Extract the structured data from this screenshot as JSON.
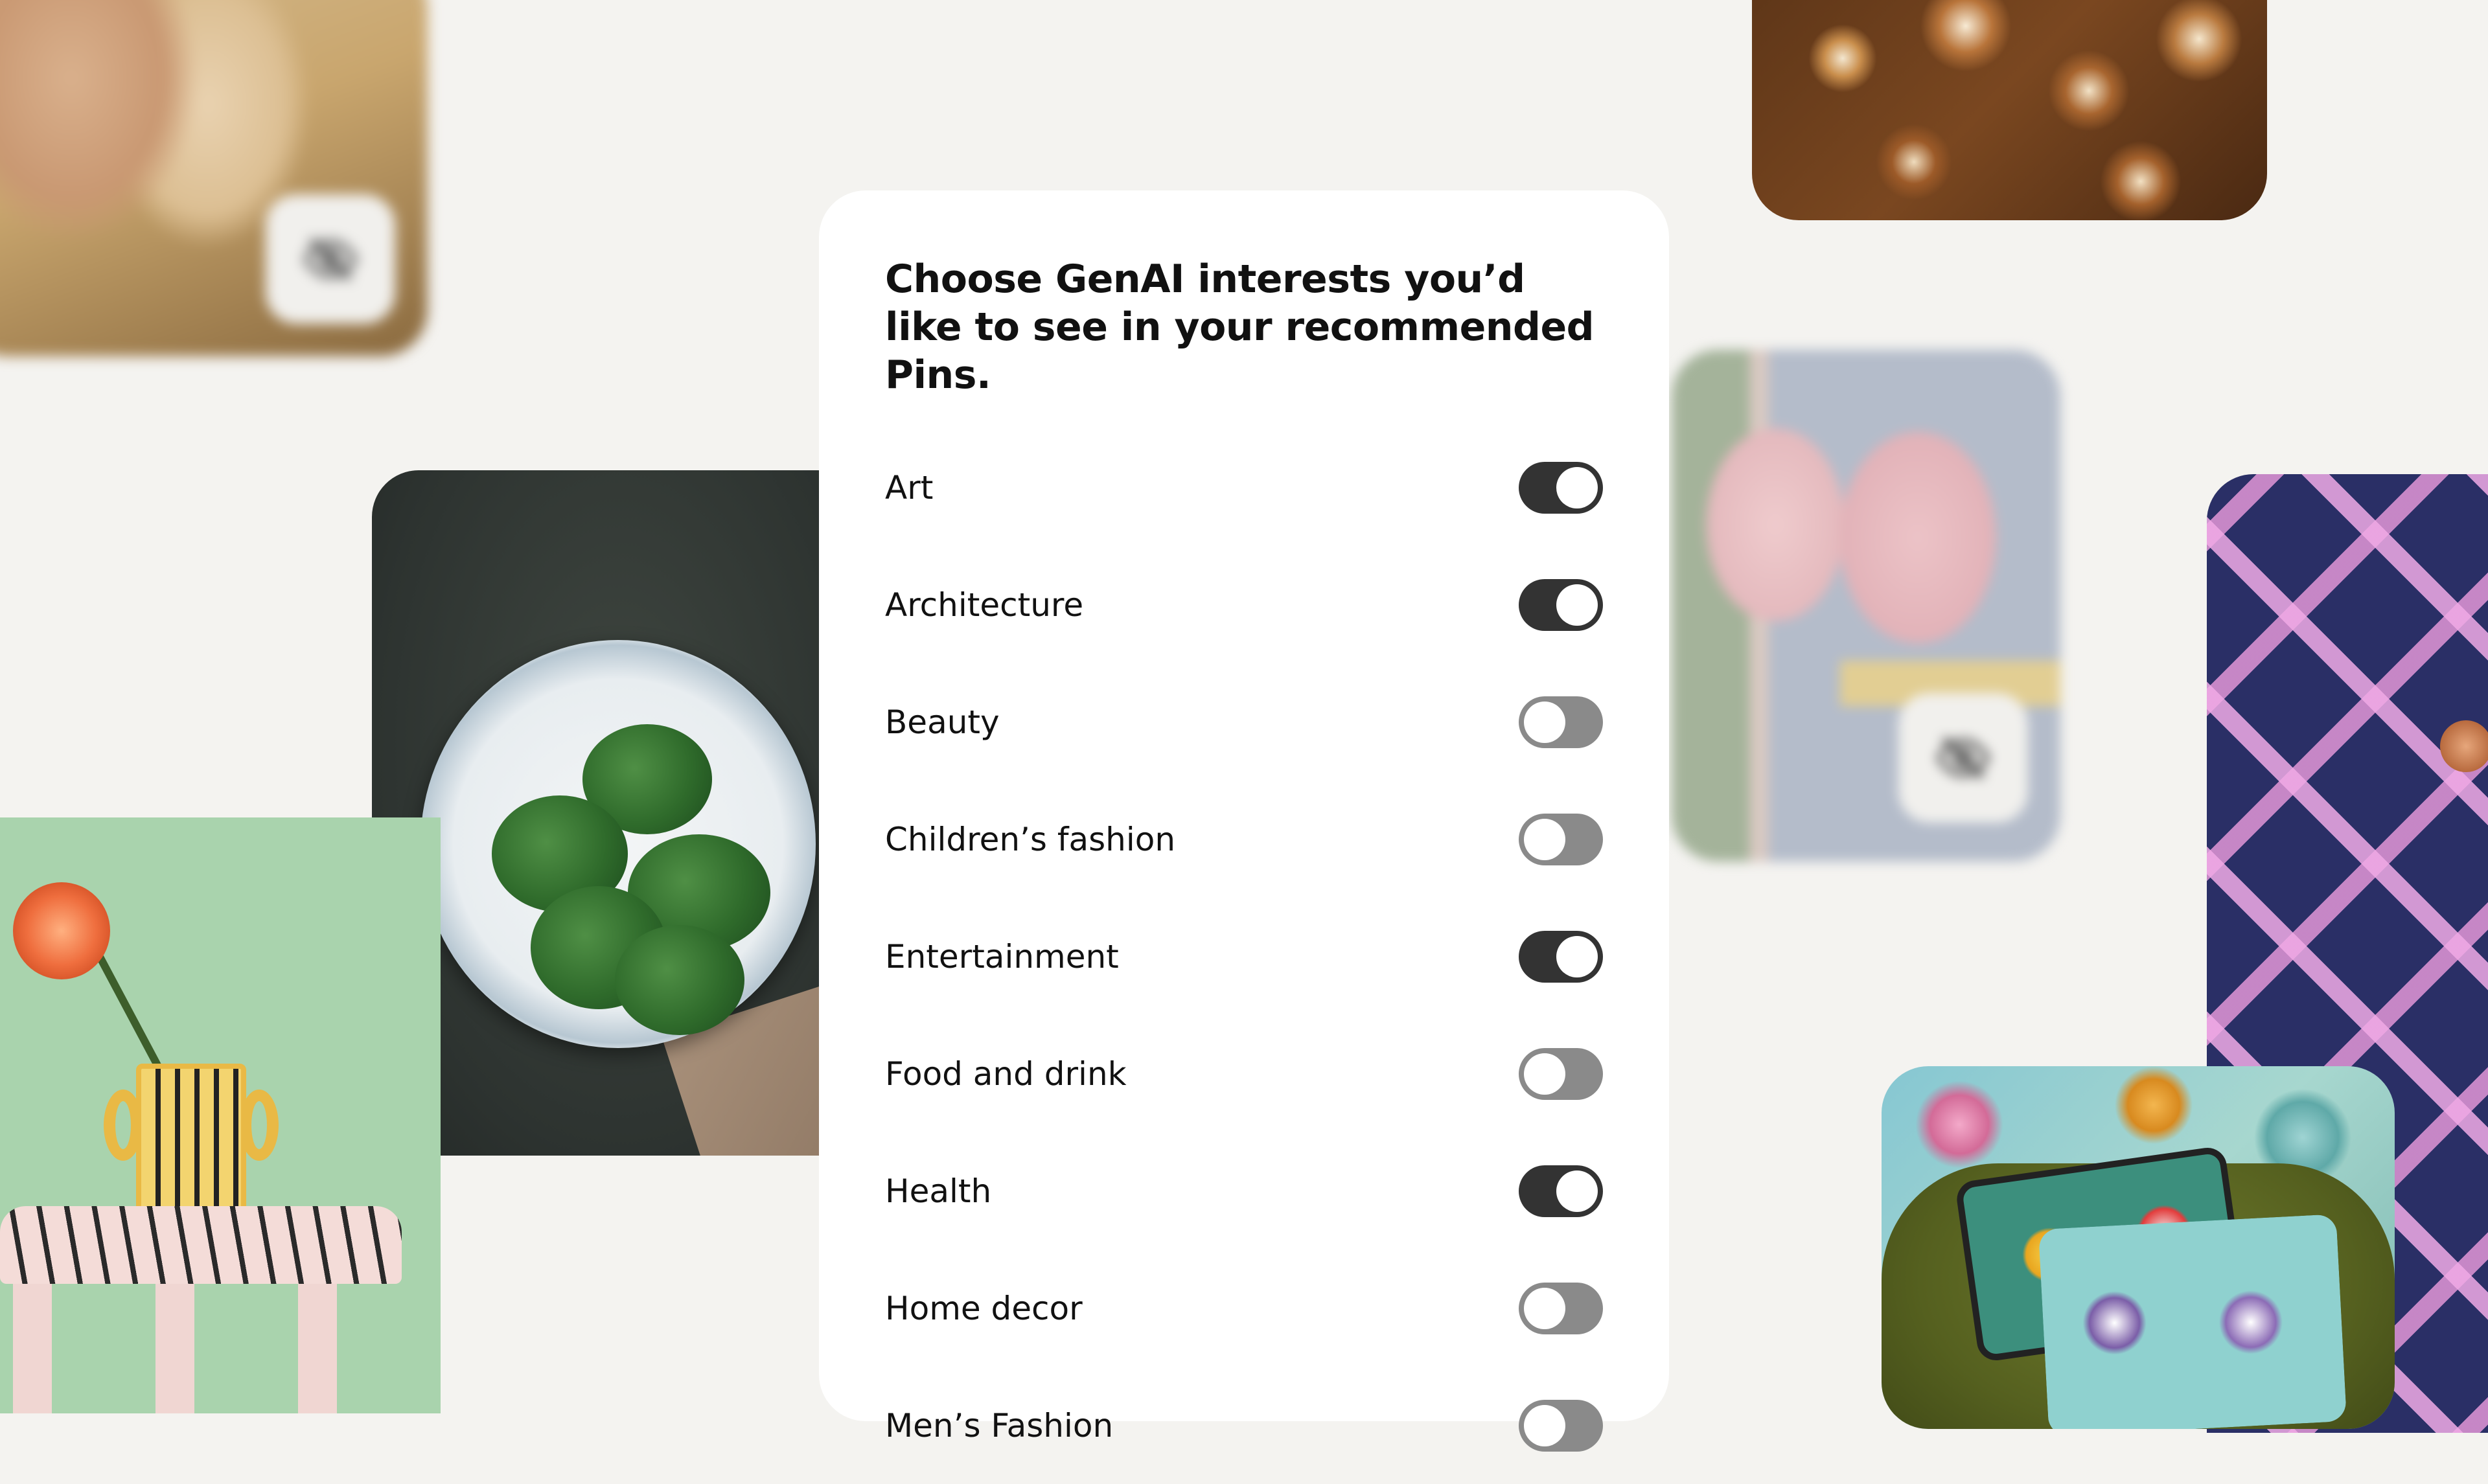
{
  "dialog": {
    "title": "Choose GenAI interests you’d like to see in your recommended Pins.",
    "interests": [
      {
        "label": "Art",
        "enabled": true
      },
      {
        "label": "Architecture",
        "enabled": true
      },
      {
        "label": "Beauty",
        "enabled": false
      },
      {
        "label": "Children’s fashion",
        "enabled": false
      },
      {
        "label": "Entertainment",
        "enabled": true
      },
      {
        "label": "Food and drink",
        "enabled": false
      },
      {
        "label": "Health",
        "enabled": true
      },
      {
        "label": "Home decor",
        "enabled": false
      },
      {
        "label": "Men’s Fashion",
        "enabled": false
      }
    ]
  },
  "background_tiles": [
    {
      "name": "blurred-portrait-image",
      "hidden_badge_icon": "eye-slash-icon"
    },
    {
      "name": "pastry-image"
    },
    {
      "name": "blurred-tennis-rackets-image",
      "hidden_badge_icon": "eye-slash-icon"
    },
    {
      "name": "cabbage-rolls-plate-image"
    },
    {
      "name": "vase-on-stool-image"
    },
    {
      "name": "plaid-jacket-image"
    },
    {
      "name": "floral-armchair-image"
    }
  ],
  "colors": {
    "page_background": "#f4f3f0",
    "card_background": "#ffffff",
    "toggle_on": "#333333",
    "toggle_off": "#8a8a8a",
    "text": "#111111"
  }
}
